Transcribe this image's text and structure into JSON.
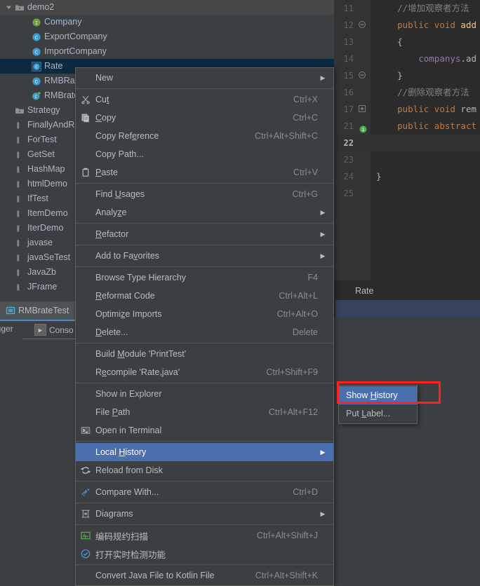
{
  "colors": {
    "panel_bg": "#3C3F41",
    "editor_bg": "#2B2B2B",
    "gutter_bg": "#313335",
    "menu_bg": "#3C3F41",
    "menu_border": "#5E6060",
    "menu_highlight": "#4B6EAF",
    "tree_selected": "#0D293E",
    "tab_underline": "#4A88C7",
    "highlight_box": "#FF1F1F",
    "text": "#A9B7C6",
    "keyword": "#CC7832",
    "field": "#9876AA",
    "method": "#FFC66D",
    "comment": "#808080",
    "interface_icon": "#6B9E3F",
    "class_icon": "#3E9BCD"
  },
  "project_tree": {
    "items": [
      {
        "label": "demo2",
        "indent": 0,
        "twisty": "expanded",
        "icon": "folder-icon",
        "state": "hover"
      },
      {
        "label": "Company",
        "indent": 2,
        "twisty": "none",
        "icon": "interface-icon",
        "state": "normal"
      },
      {
        "label": "ExportCompany",
        "indent": 2,
        "twisty": "none",
        "icon": "class-icon",
        "state": "normal"
      },
      {
        "label": "ImportCompany",
        "indent": 2,
        "twisty": "none",
        "icon": "class-icon",
        "state": "normal"
      },
      {
        "label": "Rate",
        "indent": 2,
        "twisty": "none",
        "icon": "class-icon-selected",
        "state": "selected"
      },
      {
        "label": "RMBRate",
        "indent": 2,
        "twisty": "none",
        "icon": "class-icon",
        "state": "normal"
      },
      {
        "label": "RMBrateTest",
        "indent": 2,
        "twisty": "none",
        "icon": "class-runnable-icon",
        "state": "normal"
      },
      {
        "label": "Strategy",
        "indent": 0,
        "twisty": "none",
        "icon": "folder-icon",
        "state": "normal"
      },
      {
        "label": "FinallyAndReturn",
        "indent": 0,
        "twisty": "none",
        "icon": "package-icon",
        "state": "normal"
      },
      {
        "label": "ForTest",
        "indent": 0,
        "twisty": "none",
        "icon": "package-icon",
        "state": "normal"
      },
      {
        "label": "GetSet",
        "indent": 0,
        "twisty": "none",
        "icon": "package-icon",
        "state": "normal"
      },
      {
        "label": "HashMap",
        "indent": 0,
        "twisty": "none",
        "icon": "package-icon",
        "state": "normal"
      },
      {
        "label": "htmlDemo",
        "indent": 0,
        "twisty": "none",
        "icon": "package-icon",
        "state": "normal"
      },
      {
        "label": "IfTest",
        "indent": 0,
        "twisty": "none",
        "icon": "package-icon",
        "state": "normal"
      },
      {
        "label": "ItemDemo",
        "indent": 0,
        "twisty": "none",
        "icon": "package-icon",
        "state": "normal"
      },
      {
        "label": "IterDemo",
        "indent": 0,
        "twisty": "none",
        "icon": "package-icon",
        "state": "normal"
      },
      {
        "label": "javase",
        "indent": 0,
        "twisty": "none",
        "icon": "package-icon",
        "state": "normal"
      },
      {
        "label": "javaSeTest",
        "indent": 0,
        "twisty": "none",
        "icon": "package-icon",
        "state": "normal"
      },
      {
        "label": "JavaZb",
        "indent": 0,
        "twisty": "none",
        "icon": "package-icon",
        "state": "normal"
      },
      {
        "label": "JFrame",
        "indent": 0,
        "twisty": "none",
        "icon": "package-icon",
        "state": "normal"
      }
    ]
  },
  "editor": {
    "lines": [
      {
        "num": "11",
        "fold": "",
        "current": false,
        "tokens": [
          {
            "t": "    ",
            "c": "pl"
          },
          {
            "t": "//增加观察者方法",
            "c": "cm"
          }
        ]
      },
      {
        "num": "12",
        "fold": "-",
        "current": false,
        "tokens": [
          {
            "t": "    ",
            "c": "pl"
          },
          {
            "t": "public void ",
            "c": "k"
          },
          {
            "t": "add",
            "c": "mth"
          }
        ]
      },
      {
        "num": "13",
        "fold": "",
        "current": false,
        "tokens": [
          {
            "t": "    {",
            "c": "pl"
          }
        ]
      },
      {
        "num": "14",
        "fold": "",
        "current": false,
        "tokens": [
          {
            "t": "        ",
            "c": "pl"
          },
          {
            "t": "companys",
            "c": "fld"
          },
          {
            "t": ".ad",
            "c": "pl"
          }
        ]
      },
      {
        "num": "15",
        "fold": "-",
        "current": false,
        "tokens": [
          {
            "t": "    }",
            "c": "pl"
          }
        ]
      },
      {
        "num": "16",
        "fold": "",
        "current": false,
        "tokens": [
          {
            "t": "    ",
            "c": "pl"
          },
          {
            "t": "//删除观察者方法",
            "c": "cm"
          }
        ]
      },
      {
        "num": "17",
        "fold": "+",
        "current": false,
        "tokens": [
          {
            "t": "    ",
            "c": "pl"
          },
          {
            "t": "public void ",
            "c": "k"
          },
          {
            "t": "rem",
            "c": "pl"
          }
        ]
      },
      {
        "num": "21",
        "fold": "",
        "current": false,
        "bulb": true,
        "tokens": [
          {
            "t": "    ",
            "c": "pl"
          },
          {
            "t": "public abstract",
            "c": "k"
          }
        ]
      },
      {
        "num": "22",
        "fold": "",
        "current": true,
        "tokens": [
          {
            "t": "",
            "c": "pl"
          }
        ]
      },
      {
        "num": "23",
        "fold": "",
        "current": false,
        "tokens": [
          {
            "t": "",
            "c": "pl"
          }
        ]
      },
      {
        "num": "24",
        "fold": "",
        "current": false,
        "tokens": [
          {
            "t": "}",
            "c": "pl"
          }
        ]
      },
      {
        "num": "25",
        "fold": "",
        "current": false,
        "tokens": [
          {
            "t": "",
            "c": "pl"
          }
        ]
      }
    ],
    "tab_label": "Rate"
  },
  "bottom": {
    "run_tab_label": "RMBrateTest",
    "debugger_tab_label": "ugger",
    "console_tab_label": "Conso"
  },
  "context_menu": {
    "items": [
      {
        "label": "New",
        "icon": "",
        "shortcut": "",
        "arrow": true,
        "selected": false,
        "mnemonic": -1
      },
      {
        "sep": true
      },
      {
        "label": "Cut",
        "icon": "scissors-icon",
        "shortcut": "Ctrl+X",
        "arrow": false,
        "selected": false,
        "mnemonic": 2
      },
      {
        "label": "Copy",
        "icon": "copy-icon",
        "shortcut": "Ctrl+C",
        "arrow": false,
        "selected": false,
        "mnemonic": 0
      },
      {
        "label": "Copy Reference",
        "icon": "",
        "shortcut": "Ctrl+Alt+Shift+C",
        "arrow": false,
        "selected": false,
        "mnemonic": 8
      },
      {
        "label": "Copy Path...",
        "icon": "",
        "shortcut": "",
        "arrow": false,
        "selected": false,
        "mnemonic": -1
      },
      {
        "label": "Paste",
        "icon": "clipboard-icon",
        "shortcut": "Ctrl+V",
        "arrow": false,
        "selected": false,
        "mnemonic": 0
      },
      {
        "sep": true
      },
      {
        "label": "Find Usages",
        "icon": "",
        "shortcut": "Ctrl+G",
        "arrow": false,
        "selected": false,
        "mnemonic": 5
      },
      {
        "label": "Analyze",
        "icon": "",
        "shortcut": "",
        "arrow": true,
        "selected": false,
        "mnemonic": 5
      },
      {
        "sep": true
      },
      {
        "label": "Refactor",
        "icon": "",
        "shortcut": "",
        "arrow": true,
        "selected": false,
        "mnemonic": 0
      },
      {
        "sep": true
      },
      {
        "label": "Add to Favorites",
        "icon": "",
        "shortcut": "",
        "arrow": true,
        "selected": false,
        "mnemonic": 9
      },
      {
        "sep": true
      },
      {
        "label": "Browse Type Hierarchy",
        "icon": "",
        "shortcut": "F4",
        "arrow": false,
        "selected": false,
        "mnemonic": -1
      },
      {
        "label": "Reformat Code",
        "icon": "",
        "shortcut": "Ctrl+Alt+L",
        "arrow": false,
        "selected": false,
        "mnemonic": 0
      },
      {
        "label": "Optimize Imports",
        "icon": "",
        "shortcut": "Ctrl+Alt+O",
        "arrow": false,
        "selected": false,
        "mnemonic": 6
      },
      {
        "label": "Delete...",
        "icon": "",
        "shortcut": "Delete",
        "arrow": false,
        "selected": false,
        "mnemonic": 0
      },
      {
        "sep": true
      },
      {
        "label": "Build Module 'PrintTest'",
        "icon": "",
        "shortcut": "",
        "arrow": false,
        "selected": false,
        "mnemonic": 6
      },
      {
        "label": "Recompile 'Rate,java'",
        "icon": "",
        "shortcut": "Ctrl+Shift+F9",
        "arrow": false,
        "selected": false,
        "mnemonic": 1
      },
      {
        "sep": true
      },
      {
        "label": "Show in Explorer",
        "icon": "",
        "shortcut": "",
        "arrow": false,
        "selected": false,
        "mnemonic": -1
      },
      {
        "label": "File Path",
        "icon": "",
        "shortcut": "Ctrl+Alt+F12",
        "arrow": false,
        "selected": false,
        "mnemonic": 5
      },
      {
        "label": "Open in Terminal",
        "icon": "terminal-icon",
        "shortcut": "",
        "arrow": false,
        "selected": false,
        "mnemonic": -1
      },
      {
        "sep": true
      },
      {
        "label": "Local History",
        "icon": "",
        "shortcut": "",
        "arrow": true,
        "selected": true,
        "mnemonic": 6
      },
      {
        "label": "Reload from Disk",
        "icon": "refresh-icon",
        "shortcut": "",
        "arrow": false,
        "selected": false,
        "mnemonic": -1
      },
      {
        "sep": true
      },
      {
        "label": "Compare With...",
        "icon": "compare-icon",
        "shortcut": "Ctrl+D",
        "arrow": false,
        "selected": false,
        "mnemonic": -1
      },
      {
        "sep": true
      },
      {
        "label": "Diagrams",
        "icon": "diagram-icon",
        "shortcut": "",
        "arrow": true,
        "selected": false,
        "mnemonic": -1
      },
      {
        "sep": true
      },
      {
        "label": "编码规约扫描",
        "icon": "scan-icon",
        "shortcut": "Ctrl+Alt+Shift+J",
        "arrow": false,
        "selected": false,
        "mnemonic": -1
      },
      {
        "label": "打开实时检测功能",
        "icon": "check-circle-icon",
        "shortcut": "",
        "arrow": false,
        "selected": false,
        "mnemonic": -1
      },
      {
        "sep": true
      },
      {
        "label": "Convert Java File to Kotlin File",
        "icon": "",
        "shortcut": "Ctrl+Alt+Shift+K",
        "arrow": false,
        "selected": false,
        "mnemonic": -1
      }
    ]
  },
  "submenu": {
    "items": [
      {
        "label": "Show History",
        "selected": true,
        "mnemonic": 5
      },
      {
        "label": "Put Label...",
        "selected": false,
        "mnemonic": 4
      }
    ]
  }
}
